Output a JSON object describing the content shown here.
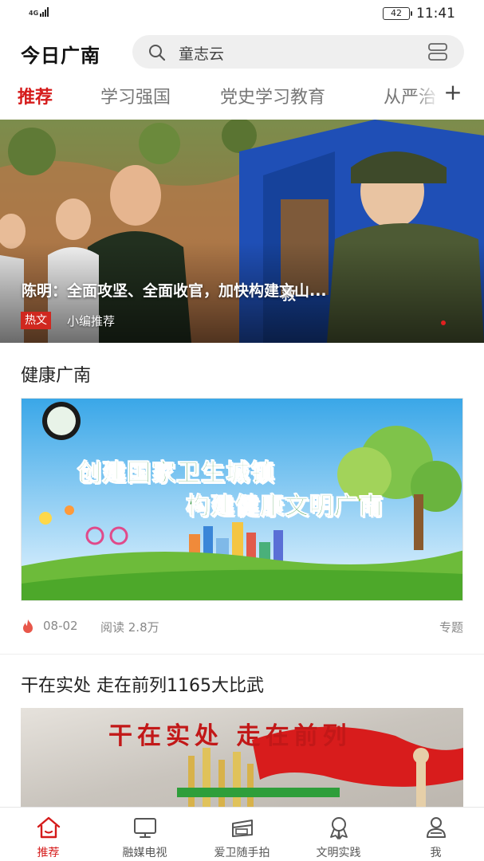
{
  "status_bar": {
    "network": "4G",
    "battery": "42",
    "time": "11:41"
  },
  "header": {
    "app_title": "今日广南",
    "search_text": "童志云",
    "icons": {
      "search": "search-icon",
      "scan": "scan-icon"
    }
  },
  "tabs": [
    {
      "label": "推荐",
      "active": true
    },
    {
      "label": "学习强国",
      "active": false
    },
    {
      "label": "党史学习教育",
      "active": false
    },
    {
      "label": "从严治",
      "active": false
    }
  ],
  "tabs_more": "+",
  "banner": {
    "title": "陈明：全面攻坚、全面收官，加快构建文山...",
    "tag": "热文",
    "subtitle": "小编推荐",
    "tent_text": "救"
  },
  "section1": {
    "title": "健康广南",
    "image_line1": "创建国家卫生城镇",
    "image_line2": "构建健康文明广南",
    "date": "08-02",
    "reads": "阅读 2.8万",
    "type": "专题"
  },
  "section2": {
    "title": "干在实处 走在前列1165大比武",
    "image_text": "干在实处 走在前列"
  },
  "bottom_nav": [
    {
      "label": "推荐",
      "icon": "home-icon",
      "active": true
    },
    {
      "label": "融媒电视",
      "icon": "tv-icon",
      "active": false
    },
    {
      "label": "爱卫随手拍",
      "icon": "camera-icon",
      "active": false
    },
    {
      "label": "文明实践",
      "icon": "award-icon",
      "active": false
    },
    {
      "label": "我",
      "icon": "user-icon",
      "active": false
    }
  ],
  "colors": {
    "accent": "#d51b1b",
    "tag_red": "#d0281f",
    "promo_green": "#1f8a2d"
  }
}
